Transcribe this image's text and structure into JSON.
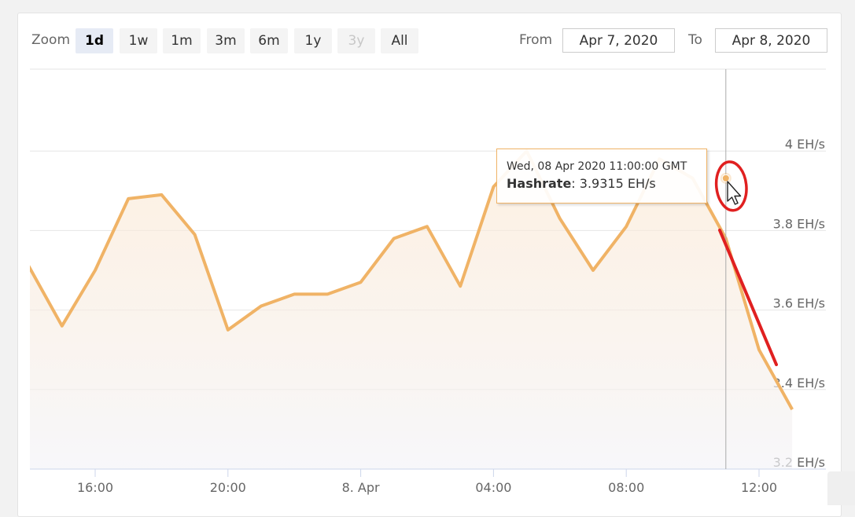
{
  "toolbar": {
    "zoom_label": "Zoom",
    "zoom_buttons": [
      {
        "label": "1d",
        "state": "active"
      },
      {
        "label": "1w",
        "state": "normal"
      },
      {
        "label": "1m",
        "state": "normal"
      },
      {
        "label": "3m",
        "state": "normal"
      },
      {
        "label": "6m",
        "state": "normal"
      },
      {
        "label": "1y",
        "state": "normal"
      },
      {
        "label": "3y",
        "state": "disabled"
      },
      {
        "label": "All",
        "state": "normal"
      }
    ],
    "from_label": "From",
    "from_value": "Apr 7, 2020",
    "to_label": "To",
    "to_value": "Apr 8, 2020"
  },
  "tooltip": {
    "date": "Wed, 08 Apr 2020 11:00:00 GMT",
    "series_name": "Hashrate",
    "value_text": "3.9315 EH/s"
  },
  "colors": {
    "line": "#f0b366",
    "annotation": "#e02020",
    "grid": "#e6e6e6"
  },
  "chart_data": {
    "type": "area",
    "x_unit": "hour offset from Apr 7, 2020 15:00",
    "x_ticks": [
      {
        "label": "16:00",
        "x": 1
      },
      {
        "label": "20:00",
        "x": 5
      },
      {
        "label": "8. Apr",
        "x": 9
      },
      {
        "label": "04:00",
        "x": 13
      },
      {
        "label": "08:00",
        "x": 17
      },
      {
        "label": "12:00",
        "x": 21
      }
    ],
    "y_ticks": [
      {
        "label": "3.2 EH/s",
        "value": 3.2
      },
      {
        "label": "3.4 EH/s",
        "value": 3.4
      },
      {
        "label": "3.6 EH/s",
        "value": 3.6
      },
      {
        "label": "3.8 EH/s",
        "value": 3.8
      },
      {
        "label": "4 EH/s",
        "value": 4.0
      }
    ],
    "ylim": [
      3.2,
      4.2
    ],
    "xlim": [
      -1.9,
      22.0
    ],
    "series": [
      {
        "name": "Hashrate",
        "x": [
          -1.9,
          -1,
          0,
          1,
          2,
          3,
          4,
          5,
          6,
          7,
          8,
          9,
          10,
          11,
          12,
          13,
          14,
          15,
          16,
          17,
          18,
          19,
          20,
          21,
          22
        ],
        "values": [
          3.73,
          3.71,
          3.56,
          3.7,
          3.88,
          3.89,
          3.79,
          3.55,
          3.61,
          3.64,
          3.64,
          3.67,
          3.78,
          3.81,
          3.66,
          3.91,
          4.0,
          3.83,
          3.7,
          3.81,
          3.98,
          3.9315,
          3.78,
          3.5,
          3.35
        ]
      }
    ],
    "highlight": {
      "x": 20,
      "value": 3.9315
    },
    "legend": "none",
    "grid": true
  }
}
